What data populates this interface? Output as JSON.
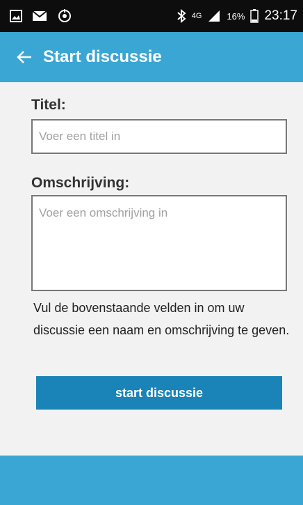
{
  "status_bar": {
    "network_type": "4G",
    "battery_percent": "16%",
    "time": "23:17",
    "icons": [
      "gallery-icon",
      "mail-icon",
      "sync-icon",
      "bluetooth-icon",
      "signal-icon",
      "battery-icon"
    ]
  },
  "app_bar": {
    "title": "Start discussie",
    "back_icon": "arrow-left-icon",
    "color": "#3aa6d4"
  },
  "form": {
    "title_label": "Titel:",
    "title_placeholder": "Voer een titel in",
    "title_value": "",
    "description_label": "Omschrijving:",
    "description_placeholder": "Voer een omschrijving in",
    "description_value": "",
    "help_text": "Vul de bovenstaande velden in om uw discussie een naam en omschrijving te geven.",
    "submit_label": "start discussie",
    "submit_color": "#1a84b8"
  }
}
